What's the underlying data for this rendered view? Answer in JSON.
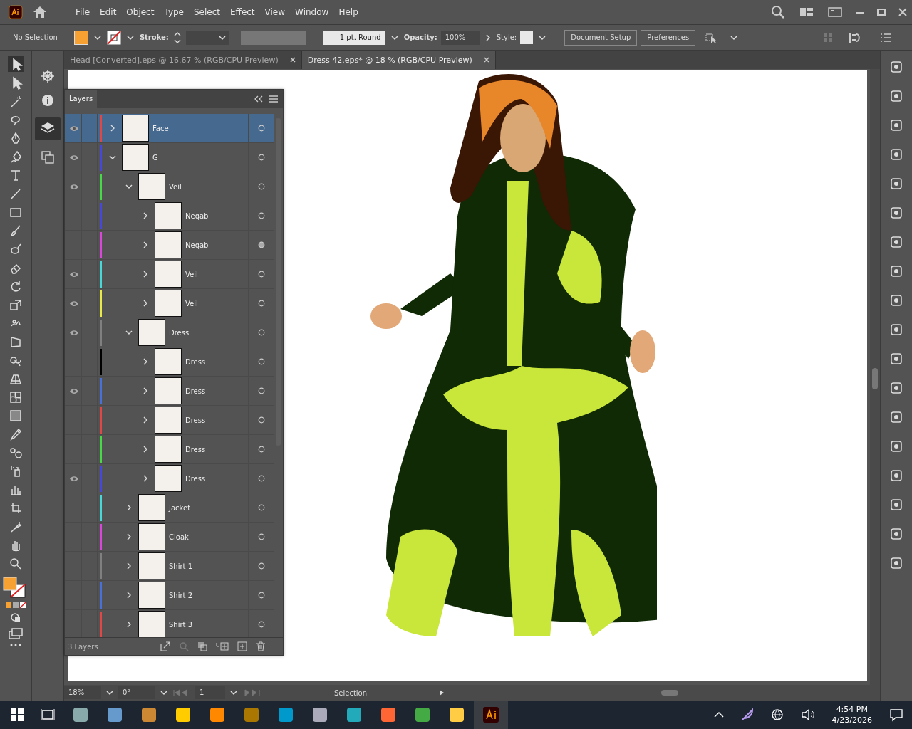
{
  "menu": [
    "File",
    "Edit",
    "Object",
    "Type",
    "Select",
    "Effect",
    "View",
    "Window",
    "Help"
  ],
  "control_bar": {
    "selection": "No Selection",
    "stroke_label": "Stroke:",
    "brush": "1 pt. Round",
    "opacity_label": "Opacity:",
    "opacity": "100%",
    "style_label": "Style:",
    "buttons": [
      "Document Setup",
      "Preferences"
    ]
  },
  "document_tabs": [
    {
      "title": "Head [Converted].eps @ 16.67 % (RGB/CPU Preview)",
      "selected": false
    },
    {
      "title": "Dress 42.eps* @ 18 % (RGB/CPU Preview)",
      "selected": true
    }
  ],
  "layers_panel": {
    "title": "Layers",
    "footer": "3 Layers",
    "layers": [
      {
        "name": "Face",
        "visible": true,
        "color": "#e04848",
        "expanded": false,
        "selected": true,
        "targeted": false
      },
      {
        "name": "G",
        "visible": true,
        "color": "#4848d8",
        "expanded": true,
        "selected": false,
        "targeted": false,
        "children": [
          {
            "name": "Veil",
            "visible": true,
            "color": "#48d848",
            "expanded": true,
            "selected": false,
            "targeted": false,
            "children": [
              {
                "name": "Neqab",
                "visible": false,
                "color": "#4848d8",
                "expanded": false,
                "selected": false,
                "targeted": false
              },
              {
                "name": "Neqab",
                "visible": false,
                "color": "#d848d8",
                "expanded": false,
                "selected": false,
                "targeted": true
              },
              {
                "name": "Veil",
                "visible": true,
                "color": "#48d8d8",
                "expanded": false,
                "selected": false,
                "targeted": false
              },
              {
                "name": "Veil",
                "visible": true,
                "color": "#e8e848",
                "expanded": false,
                "selected": false,
                "targeted": false
              }
            ]
          },
          {
            "name": "Dress",
            "visible": true,
            "color": "#808080",
            "expanded": true,
            "selected": false,
            "targeted": false,
            "children": [
              {
                "name": "Dress",
                "visible": false,
                "color": "#000000",
                "expanded": false,
                "selected": false,
                "targeted": false
              },
              {
                "name": "Dress",
                "visible": true,
                "color": "#4870d8",
                "expanded": false,
                "selected": false,
                "targeted": false
              },
              {
                "name": "Dress",
                "visible": false,
                "color": "#e04848",
                "expanded": false,
                "selected": false,
                "targeted": false
              },
              {
                "name": "Dress",
                "visible": false,
                "color": "#48d848",
                "expanded": false,
                "selected": false,
                "targeted": false
              },
              {
                "name": "Dress",
                "visible": true,
                "color": "#4848d8",
                "expanded": false,
                "selected": false,
                "targeted": false
              }
            ]
          },
          {
            "name": "Jacket",
            "visible": false,
            "color": "#48d8d8",
            "expanded": false,
            "selected": false,
            "targeted": false
          },
          {
            "name": "Cloak",
            "visible": false,
            "color": "#d848d8",
            "expanded": false,
            "selected": false,
            "targeted": false
          },
          {
            "name": "Shirt 1",
            "visible": false,
            "color": "#808080",
            "expanded": false,
            "selected": false,
            "targeted": false
          },
          {
            "name": "Shirt 2",
            "visible": false,
            "color": "#4870d8",
            "expanded": false,
            "selected": false,
            "targeted": false
          },
          {
            "name": "Shirt 3",
            "visible": false,
            "color": "#e04848",
            "expanded": false,
            "selected": false,
            "targeted": false
          }
        ]
      }
    ]
  },
  "status_bar": {
    "zoom": "18%",
    "rotation": "0°",
    "artboard": "1",
    "tool": "Selection"
  },
  "taskbar": {
    "time": "4:54 PM",
    "date": "4/23/2026"
  }
}
